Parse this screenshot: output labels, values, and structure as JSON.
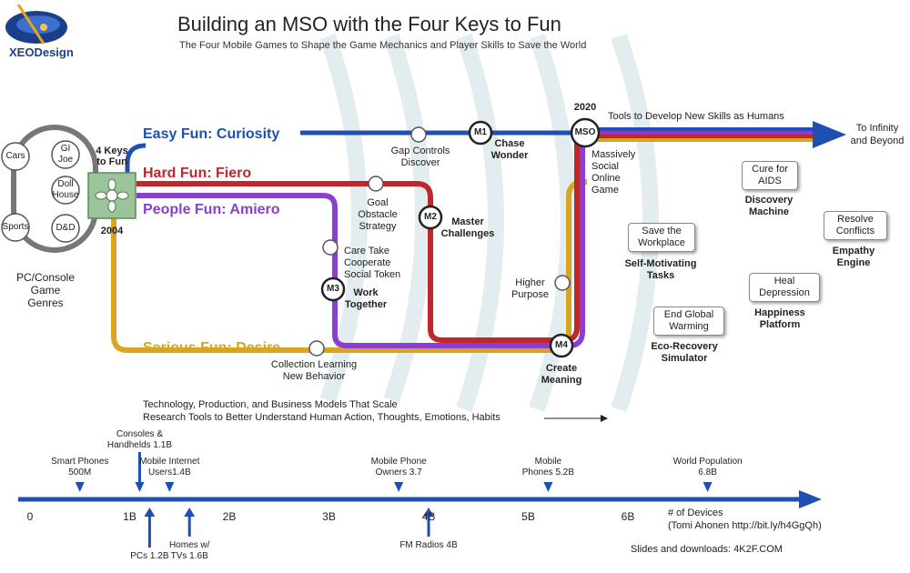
{
  "header": {
    "logo_text": "XEODesign",
    "title": "Building an MSO with the Four Keys to Fun",
    "subtitle": "The Four Mobile Games to Shape the Game Mechanics and Player Skills to Save the World"
  },
  "genres": {
    "items": [
      "Cars",
      "GI\nJoe",
      "Doll\nHouse",
      "Sports",
      "D&D"
    ],
    "caption": "PC/Console\nGame\nGenres"
  },
  "keys": {
    "label": "4 Keys\nto Fun",
    "year": "2004"
  },
  "lines": {
    "easy": {
      "label": "Easy Fun: Curiosity",
      "color": "#1f4fb3"
    },
    "hard": {
      "label": "Hard Fun: Fiero",
      "color": "#c0272d"
    },
    "people": {
      "label": "People Fun: Amiero",
      "color": "#8a3fd1"
    },
    "serious": {
      "label": "Serious Fun: Desire",
      "color": "#d9a521"
    }
  },
  "stops": {
    "gap": "Gap Controls\nDiscover",
    "goal": "Goal\nObstacle\nStrategy",
    "care": "Care Take\nCooperate\nSocial Token",
    "purpose": "Higher\nPurpose",
    "collection": "Collection Learning\nNew Behavior"
  },
  "milestones": {
    "m1": {
      "badge": "M1",
      "label": "Chase\nWonder"
    },
    "m2": {
      "badge": "M2",
      "label": "Master\nChallenges"
    },
    "m3": {
      "badge": "M3",
      "label": "Work\nTogether"
    },
    "m4": {
      "badge": "M4",
      "label": "Create\nMeaning"
    },
    "mso": {
      "badge": "MSO",
      "year": "2020",
      "label": "Massively\nSocial\nOnline\nGame"
    }
  },
  "tools_text": "Tools to Develop New Skills as Humans",
  "infinity": "To Infinity\nand Beyond",
  "goals": [
    {
      "box": "Save the\nWorkplace",
      "caption": "Self-Motivating\nTasks"
    },
    {
      "box": "Cure for\nAIDS",
      "caption": "Discovery\nMachine"
    },
    {
      "box": "Resolve\nConflicts",
      "caption": "Empathy\nEngine"
    },
    {
      "box": "Heal\nDepression",
      "caption": "Happiness\nPlatform"
    },
    {
      "box": "End Global\nWarming",
      "caption": "Eco-Recovery\nSimulator"
    }
  ],
  "tech_lines": [
    "Technology, Production, and Business Models That Scale",
    "Research Tools to Better Understand Human Action, Thoughts, Emotions, Habits"
  ],
  "axis": {
    "ticks": [
      "0",
      "1B",
      "2B",
      "3B",
      "4B",
      "5B",
      "6B"
    ],
    "devices_label": "# of Devices\n(Tomi Ahonen http://bit.ly/h4GgQh)",
    "above": [
      {
        "text": "Smart Phones\n500M",
        "value": 0.5
      },
      {
        "text": "Consoles &\nHandhelds 1.1B",
        "value": 1.1
      },
      {
        "text": "Mobile Internet\nUsers1.4B",
        "value": 1.4
      },
      {
        "text": "Mobile Phone\nOwners 3.7",
        "value": 3.7
      },
      {
        "text": "Mobile\nPhones 5.2B",
        "value": 5.2
      },
      {
        "text": "World Population\n6.8B",
        "value": 6.8
      }
    ],
    "below": [
      {
        "text": "PCs 1.2B",
        "value": 1.2
      },
      {
        "text": "Homes w/\nTVs 1.6B",
        "value": 1.6
      },
      {
        "text": "FM Radios 4B",
        "value": 4.0
      }
    ]
  },
  "footer": "Slides and downloads: 4K2F.COM"
}
